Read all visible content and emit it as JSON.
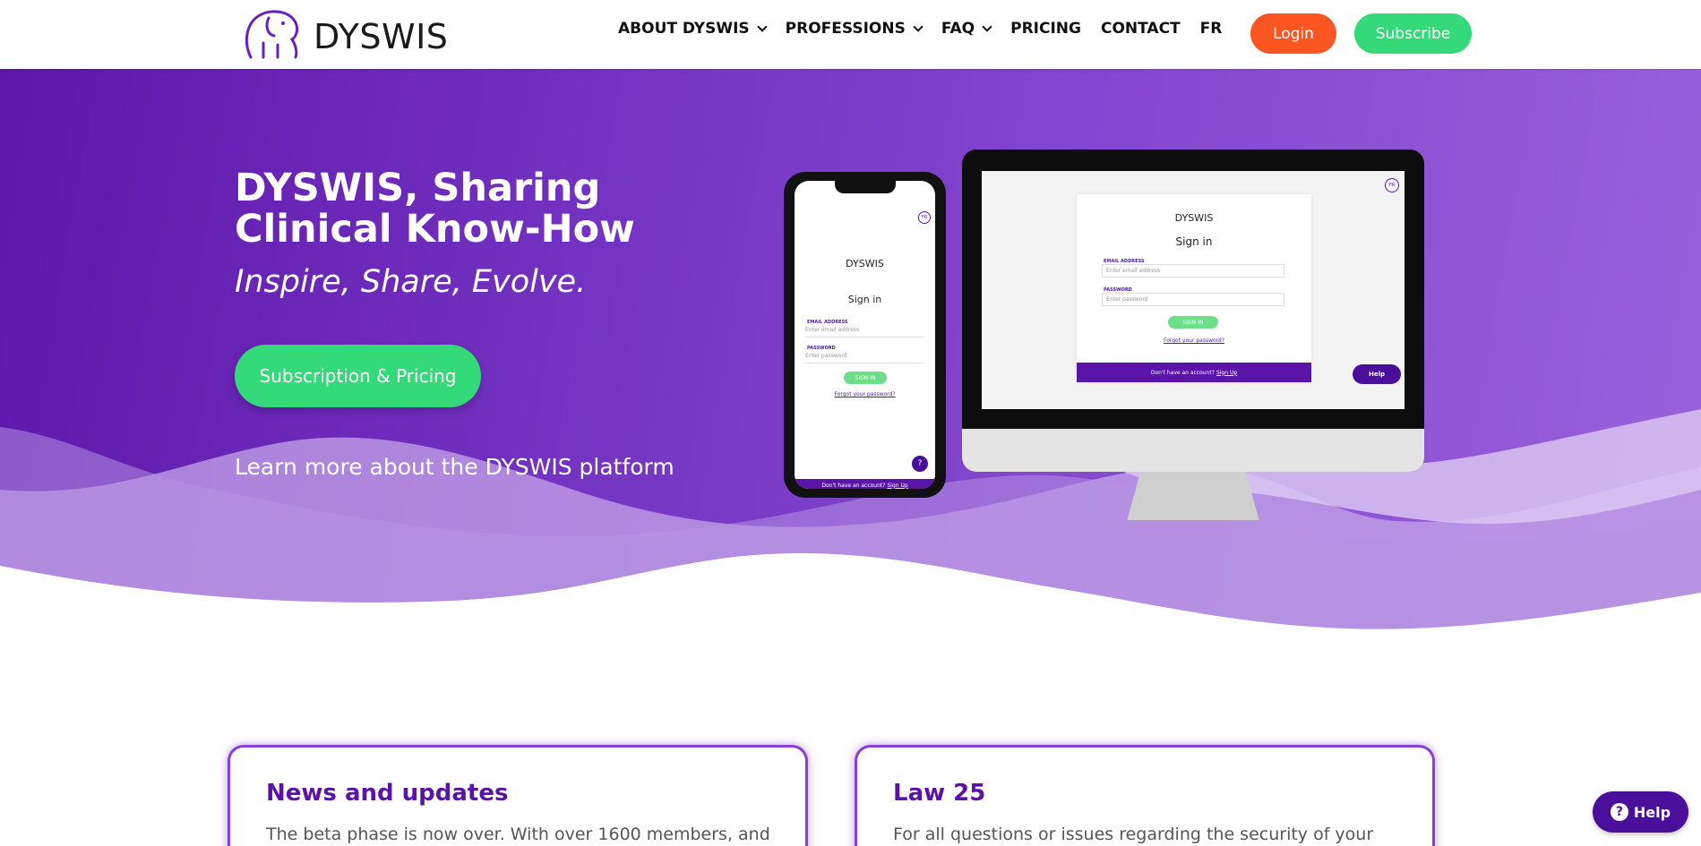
{
  "brand": {
    "name": "DYSWIS",
    "accent": "#5b14a8",
    "green": "#34d97a",
    "orange": "#fb5622"
  },
  "nav": {
    "items": [
      {
        "label": "ABOUT DYSWIS",
        "has_dropdown": true
      },
      {
        "label": "PROFESSIONS",
        "has_dropdown": true
      },
      {
        "label": "FAQ",
        "has_dropdown": true
      },
      {
        "label": "PRICING",
        "has_dropdown": false
      },
      {
        "label": "CONTACT",
        "has_dropdown": false
      },
      {
        "label": "FR",
        "has_dropdown": false
      }
    ],
    "login": "Login",
    "subscribe": "Subscribe"
  },
  "hero": {
    "title": "DYSWIS, Sharing Clinical Know-How",
    "subtitle": "Inspire, Share, Evolve.",
    "cta": "Subscription & Pricing",
    "learn_more": "Learn more about the DYSWIS platform"
  },
  "mockup": {
    "brand": "DYSWIS",
    "sign_in_title": "Sign in",
    "email_label": "EMAIL ADDRESS",
    "email_placeholder": "Enter email address",
    "password_label": "PASSWORD",
    "password_placeholder": "Enter password",
    "sign_in_button": "SIGN IN",
    "forgot": "Forgot your password?",
    "no_account": "Don't have an account?",
    "sign_up": "Sign Up",
    "lang": "FR",
    "help": "Help"
  },
  "cards": [
    {
      "title": "News and updates",
      "text": "The beta phase is now over. With over 1600 members, and"
    },
    {
      "title": "Law 25",
      "text": "For all questions or issues regarding the security of your"
    }
  ],
  "help_button": "Help"
}
